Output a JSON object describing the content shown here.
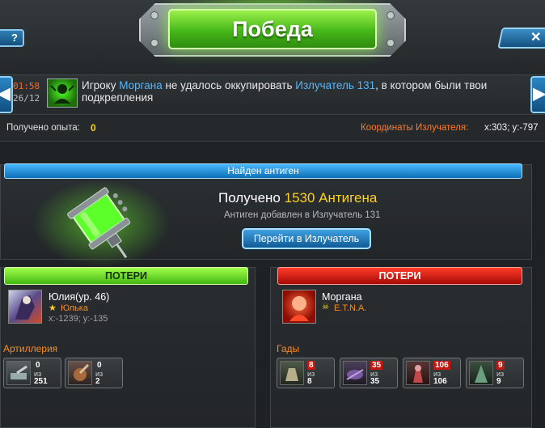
{
  "header": {
    "title": "Победа",
    "close_label": "✕",
    "left_tab_label": "?",
    "title_color": "#4fc21b"
  },
  "notification": {
    "time": "01:58",
    "date": "26/12",
    "icon": "biohazard-icon",
    "text_prefix": "Игроку ",
    "player": "Моргана",
    "text_middle": " не удалось оккупировать ",
    "target": "Излучатель 131",
    "text_suffix": ", в котором были твои подкрепления",
    "prev_label": "◀",
    "next_label": "▶"
  },
  "stats": {
    "xp_label": "Получено опыта:",
    "xp_value": "0",
    "coords_label": "Координаты Излучателя:",
    "coords_value": "x:303; y:-797"
  },
  "antigen": {
    "header": "Найден антиген",
    "received_label": "Получено",
    "received_amount": "1530 Антигена",
    "note": "Антиген добавлен в Излучатель 131",
    "button_label": "Перейти в Излучатель",
    "icon": "antigen-canister-icon"
  },
  "losses_left": {
    "header": "ПОТЕРИ",
    "player_name": "Юлия(ур. 46)",
    "clan_icon": "star-icon",
    "clan": "Юлька",
    "coords": "x:-1239; y:-135",
    "section": "Артиллерия",
    "units": [
      {
        "icon": "artillery-unit-1-icon",
        "lost": "0",
        "of": "из",
        "total": "251"
      },
      {
        "icon": "artillery-unit-2-icon",
        "lost": "0",
        "of": "из",
        "total": "2"
      }
    ]
  },
  "losses_right": {
    "header": "ПОТЕРИ",
    "player_name": "Моргана",
    "clan_icon": "skull-icon",
    "clan": "E.T.N.A.",
    "section": "Гады",
    "units": [
      {
        "icon": "creature-unit-1-icon",
        "lost": "8",
        "of": "из",
        "total": "8"
      },
      {
        "icon": "creature-unit-2-icon",
        "lost": "35",
        "of": "из",
        "total": "35"
      },
      {
        "icon": "creature-unit-3-icon",
        "lost": "106",
        "of": "из",
        "total": "106"
      },
      {
        "icon": "creature-unit-4-icon",
        "lost": "9",
        "of": "из",
        "total": "9"
      }
    ]
  }
}
